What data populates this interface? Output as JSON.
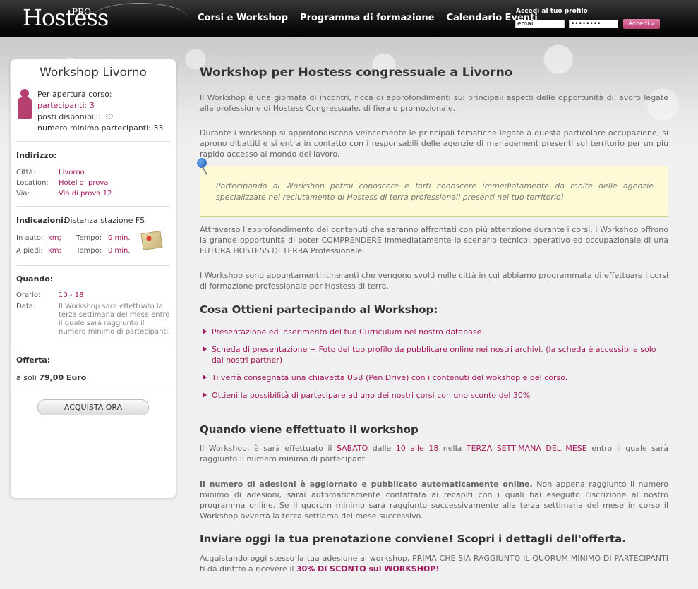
{
  "header": {
    "logo_text": "Hostess",
    "logo_sup": "PRO",
    "nav": [
      "Corsi e Workshop",
      "Programma di formazione",
      "Calendario Eventi"
    ],
    "login_label": "Accedi al tuo profilo",
    "email_value": "email",
    "password_value": "••••••••",
    "login_button": "Accedi »"
  },
  "sidebar": {
    "title": "Workshop Livorno",
    "opening_label": "Per apertura corso:",
    "participants": "partecipanti: 3",
    "available": "posti disponibili: 30",
    "minimum": "numero minimo partecipanti: 33",
    "address_heading": "Indirizzo:",
    "city_k": "Città:",
    "city_v": "Livorno",
    "location_k": "Location:",
    "location_v": "Hotel di prova",
    "street_k": "Via:",
    "street_v": "Via di prova 12",
    "directions_heading": "Indicazioni:",
    "directions_text": "Distanza stazione FS",
    "car_k": "In auto:",
    "car_km": "km;",
    "car_time_k": "Tempo:",
    "car_time_v": "0 min.",
    "walk_k": "A piedi:",
    "walk_km": "km;",
    "walk_time_k": "Tempo:",
    "walk_time_v": "0 min.",
    "when_heading": "Quando:",
    "hours_k": "Orario:",
    "hours_v": "10 - 18",
    "date_k": "Data:",
    "date_note": "Il Workshop sara effettuato la terza settimana del mese entro il quale sarà raggiunto il numero minimo di partecipanti.",
    "offer_heading": "Offerta:",
    "offer_prefix": "a soli",
    "offer_price": "79,00 Euro",
    "buy_button": "ACQUISTA ORA"
  },
  "main": {
    "title": "Workshop per Hostess congressuale a Livorno",
    "p1": "Il Workshop è una giornata di incontri, ricca di approfondimenti sui principali aspetti delle opportunità di lavoro legate alla professione di Hostess Congressuale, di fiera o promozionale.",
    "p2": "Durante i workshop si approfondiscono velocemente le principali tematiche legate a questa particolare occupazione, si aprono dibattiti e si entra in contatto con i responsabili delle agenzie di management presenti sul territorio per un più rapido accesso al mondo del lavoro.",
    "notice": "Partecipando ai Workshop potrai conoscere e farti conoscere immediatamente da molte delle agenzie specializzate nel reclutamento di Hostess di terra professionali presenti nel tuo territorio!",
    "p3": "Attraverso l'approfondimento dei contenuti che saranno affrontati con più attenzione durante i corsi, i Workshop offrono la grande opportunità di poter COMPRENDERE immediatamente lo scenario tecnico, operativo ed occupazionale di una FUTURA HOSTESS DI TERRA Professionale.",
    "p4": "I Workshop sono appuntamenti itineranti che vengono svolti nelle città in cui abbiamo programmata di effettuare i corsi di formazione professionale per Hostess di terra.",
    "h_benefits": "Cosa Ottieni partecipando al Workshop:",
    "b1": "Presentazione ed inserimento del tuo Curriculum nel nostro database",
    "b2_bold": "Scheda di presentazione + Foto",
    "b2_rest": " del tuo profilo da pubblicare online nei nostri archivi. (la scheda è accessibile solo dai nostri partner)",
    "b3_bold": "Ti verrà consegnata una chiavetta USB",
    "b3_rest": " (Pen Drive) con i contenuti del wokshop e del corso.",
    "b4": "Ottieni la possibilità di partecipare ad uno dei nostri corsi con uno sconto del 30%",
    "h_when": "Quando viene effettuato il workshop",
    "w_a": "Il Workshop, è sarà effettuato il ",
    "w_b": "SABATO",
    "w_c": " dalle ",
    "w_d": "10 alle 18",
    "w_e": " nella ",
    "w_f": "TERZA SETTIMANA DEL MESE",
    "w_g": " entro il quale sarà raggiunto il numero minimo di partecipanti.",
    "p6_bold": "Il numero di adesioni è aggiornato e pubblicato automaticamente online.",
    "p6_rest": " Non appena raggiunto il numero minimo di adesioni, sarai automaticamente contattata ai recapiti con i quali hai eseguito l'iscrizione al nostro programma online. Se il quorum minimo sarà raggiunto successivamente alla terza settimana del mese in corso il Workshop avverrà la terza settiama del mese successivo.",
    "h_offer": "Inviare oggi la tua prenotazione conviene! Scopri i dettagli dell'offerta.",
    "o_a": "Acquistando oggi stesso la tua adesione al workshop, PRIMA CHE SIA RAGGIUNTO IL QUORUM MINIMO DI PARTECIPANTI ti da dirittto a ricevere il ",
    "o_b": "30% DI SCONTO sul WORKSHOP!"
  }
}
